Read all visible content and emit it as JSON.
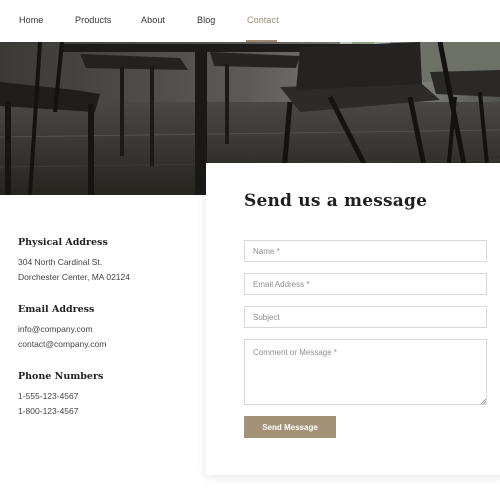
{
  "nav": {
    "items": [
      {
        "label": "Home"
      },
      {
        "label": "Products"
      },
      {
        "label": "About"
      },
      {
        "label": "Blog"
      },
      {
        "label": "Contact"
      }
    ],
    "active": "Contact",
    "accent_color": "#9c8c72"
  },
  "hero": {
    "description_icon": "dining-chairs-photo"
  },
  "contact_info": {
    "physical": {
      "heading": "Physical Address",
      "line1": "304 North Cardinal St.",
      "line2": "Dorchester Center, MA 02124"
    },
    "email": {
      "heading": "Email Address",
      "line1": "info@company.com",
      "line2": "contact@company.com"
    },
    "phone": {
      "heading": "Phone Numbers",
      "line1": "1-555-123-4567",
      "line2": "1-800-123-4567"
    }
  },
  "form": {
    "title": "Send us a message",
    "name_placeholder": "Name *",
    "email_placeholder": "Email Address *",
    "subject_placeholder": "Subject",
    "message_placeholder": "Comment or Message *",
    "submit_label": "Send Message",
    "button_color": "#a39277"
  }
}
